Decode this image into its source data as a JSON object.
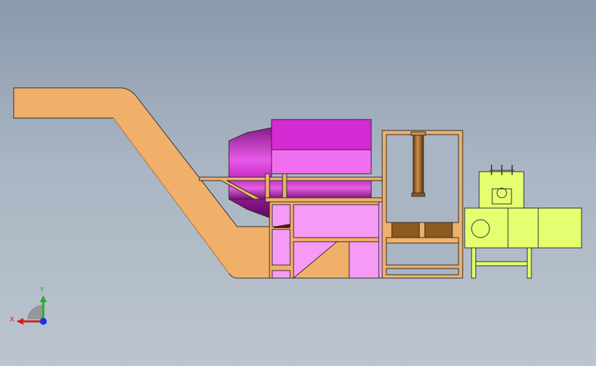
{
  "colors": {
    "background_top": "#8a9aac",
    "background_bottom": "#bcc5cf",
    "conveyor": "#f0b06a",
    "mixer_magenta": "#d42ad4",
    "mixer_pink": "#f28ef2",
    "press_frame": "#f0b06a",
    "press_cylinder": "#c08040",
    "motor_green": "#e4ff70",
    "outline": "#2a2a2a"
  },
  "triad": {
    "x_label": "X",
    "y_label": "Y",
    "x_color": "#d02020",
    "y_color": "#20b020",
    "z_color": "#2030e0"
  }
}
